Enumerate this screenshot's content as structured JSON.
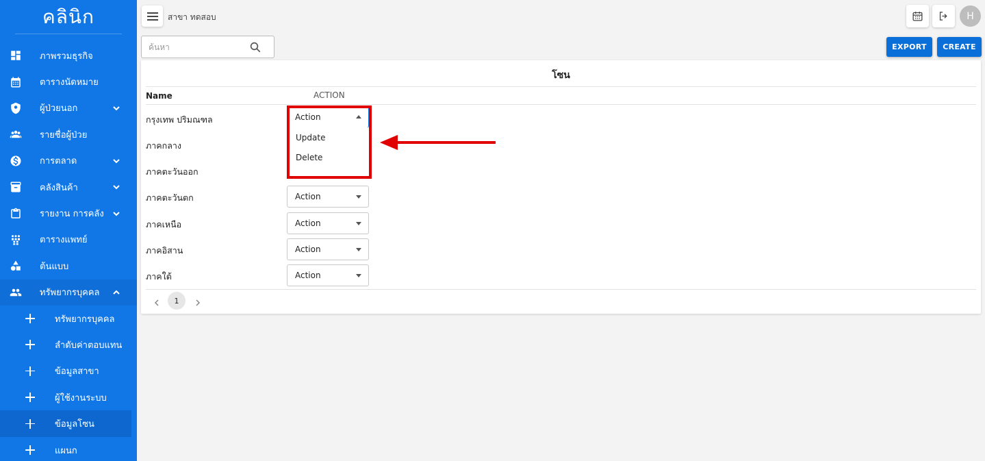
{
  "sidebar": {
    "brand": "คลินิก",
    "items": [
      {
        "label": "ภาพรวมธุรกิจ",
        "icon": "dashboard-icon",
        "expandable": false
      },
      {
        "label": "ตารางนัดหมาย",
        "icon": "calendar-icon",
        "expandable": false
      },
      {
        "label": "ผู้ป่วยนอก",
        "icon": "shield-icon",
        "expandable": true
      },
      {
        "label": "รายชื่อผู้ป่วย",
        "icon": "patients-icon",
        "expandable": false
      },
      {
        "label": "การตลาด",
        "icon": "dollar-icon",
        "expandable": true
      },
      {
        "label": "คลังสินค้า",
        "icon": "archive-icon",
        "expandable": true
      },
      {
        "label": "รายงาน การคลัง",
        "icon": "clipboard-icon",
        "expandable": true
      },
      {
        "label": "ตารางแพทย์",
        "icon": "team-icon",
        "expandable": false
      },
      {
        "label": "ต้นแบบ",
        "icon": "shapes-icon",
        "expandable": false
      },
      {
        "label": "ทรัพยากรบุคคล",
        "icon": "people-icon",
        "expandable": true,
        "open": true
      }
    ],
    "subitems": [
      {
        "label": "ทรัพยากรบุคคล"
      },
      {
        "label": "ลำดับค่าตอบแทน"
      },
      {
        "label": "ข้อมูลสาขา"
      },
      {
        "label": "ผู้ใช้งานระบบ"
      },
      {
        "label": "ข้อมูลโซน",
        "active": true
      },
      {
        "label": "แผนก"
      }
    ]
  },
  "topbar": {
    "branch": "สาขา ทดสอบ",
    "avatar_initial": "H"
  },
  "search": {
    "placeholder": "ค้นหา"
  },
  "buttons": {
    "export": "EXPORT",
    "create": "CREATE"
  },
  "table": {
    "title": "โซน",
    "col_name": "Name",
    "col_action": "ACTION",
    "rows": [
      {
        "name": "กรุงเทพ ปริมณฑล",
        "action": "Action"
      },
      {
        "name": "ภาคกลาง",
        "action": "Action"
      },
      {
        "name": "ภาคตะวันออก",
        "action": "Action"
      },
      {
        "name": "ภาคตะวันตก",
        "action": "Action"
      },
      {
        "name": "ภาคเหนือ",
        "action": "Action"
      },
      {
        "name": "ภาคอิสาน",
        "action": "Action"
      },
      {
        "name": "ภาคใต้",
        "action": "Action"
      }
    ],
    "dropdown_options": [
      "Update",
      "Delete"
    ],
    "page": "1"
  },
  "colors": {
    "sidebar": "#1177e6",
    "primary": "#0b6fd9",
    "annotation": "#e00000"
  }
}
